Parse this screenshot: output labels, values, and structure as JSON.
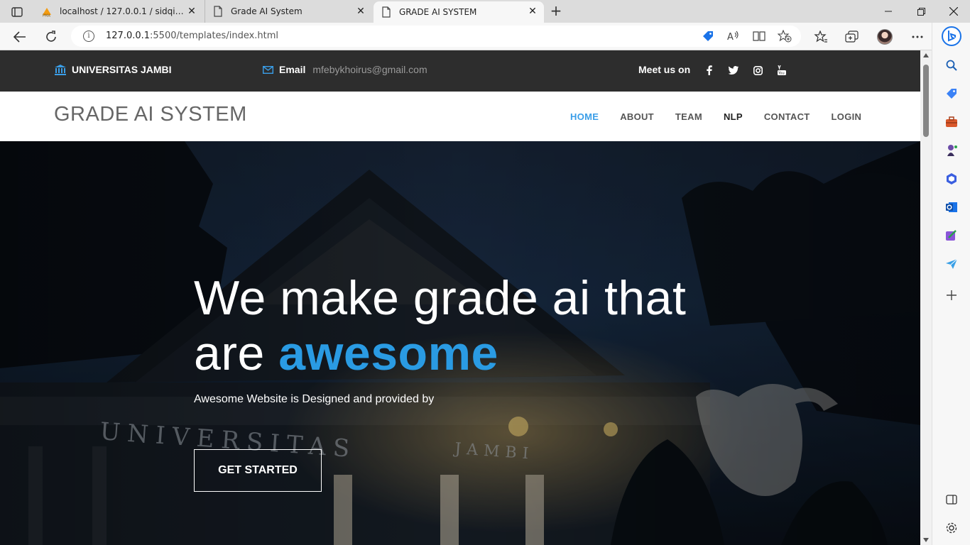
{
  "browser": {
    "tabs": [
      {
        "title": "localhost / 127.0.0.1 / sidqi_db / "
      },
      {
        "title": "Grade AI System"
      },
      {
        "title": "GRADE AI SYSTEM"
      }
    ],
    "url_host": "127.0.0.1",
    "url_path": ":5500/templates/index.html"
  },
  "topbar": {
    "university": "UNIVERSITAS JAMBI",
    "email_label": "Email",
    "email_value": "mfebykhoirus@gmail.com",
    "meet_label": "Meet us on"
  },
  "navbar": {
    "brand": "GRADE AI SYSTEM",
    "items": [
      {
        "label": "HOME"
      },
      {
        "label": "ABOUT"
      },
      {
        "label": "TEAM"
      },
      {
        "label": "NLP"
      },
      {
        "label": "CONTACT"
      },
      {
        "label": "LOGIN"
      }
    ]
  },
  "hero": {
    "headline_line1": "We make grade ai that",
    "headline_pre": "are ",
    "headline_highlight": "awesome",
    "subtitle": "Awesome Website is Designed and provided by",
    "cta": "GET STARTED",
    "background_sign": "UNIVERSITAS",
    "background_sign2": "JAMBI"
  },
  "colors": {
    "accent": "#2a9be3",
    "topbar_bg": "#2d2d2d"
  }
}
